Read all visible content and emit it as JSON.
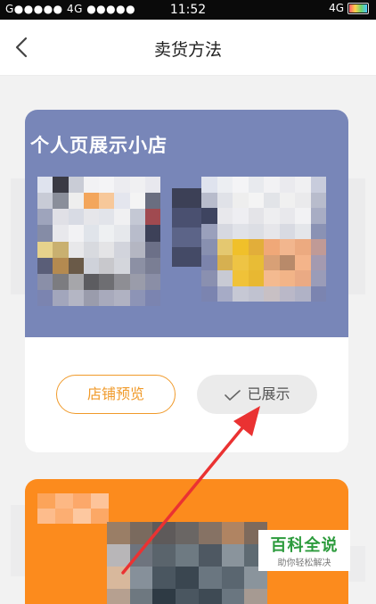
{
  "status_bar": {
    "carrier": "G●●●●● 4G ●●●●●",
    "time": "11:52",
    "network": "4G"
  },
  "nav": {
    "title": "卖货方法",
    "back_icon": "chevron-left-icon"
  },
  "card": {
    "title": "个人页展示小店",
    "preview_button": "店铺预览",
    "shown_button": "已展示",
    "check_icon": "check-icon"
  },
  "watermark": {
    "title": "百科全说",
    "subtitle": "助你轻松解决"
  },
  "colors": {
    "card_header": "#7886b8",
    "accent_orange": "#f09a2a",
    "card2_orange": "#fc8b1d",
    "arrow_red": "#ea3232",
    "watermark_green": "#2c9b3c"
  }
}
